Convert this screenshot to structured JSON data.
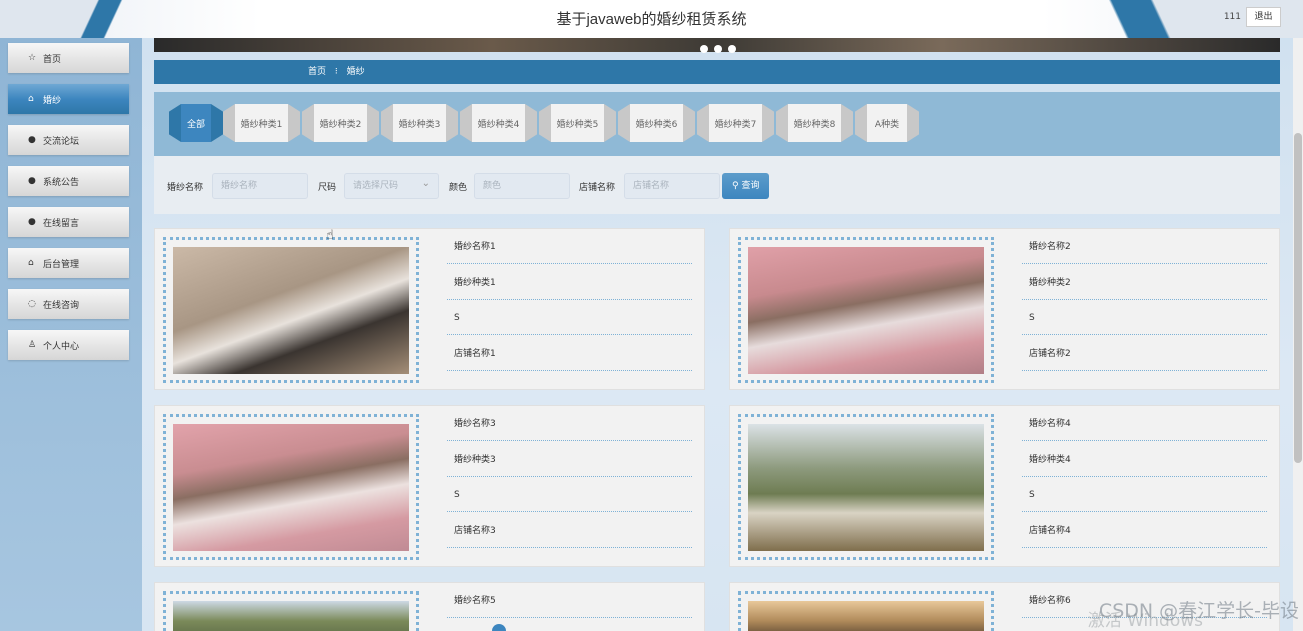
{
  "header": {
    "title": "基于javaweb的婚纱租赁系统",
    "user": "111",
    "logout_label": "退出"
  },
  "sidebar": {
    "items": [
      {
        "label": "首页",
        "icon": "☆"
      },
      {
        "label": "婚纱",
        "icon": "⌂"
      },
      {
        "label": "交流论坛",
        "icon": "●"
      },
      {
        "label": "系统公告",
        "icon": "●"
      },
      {
        "label": "在线留言",
        "icon": "●"
      },
      {
        "label": "后台管理",
        "icon": "⌂"
      },
      {
        "label": "在线咨询",
        "icon": "◌"
      },
      {
        "label": "个人中心",
        "icon": "♙"
      }
    ]
  },
  "breadcrumb": {
    "home": "首页",
    "separator": "⁝",
    "current": "婚纱"
  },
  "categories": [
    "全部",
    "婚纱种类1",
    "婚纱种类2",
    "婚纱种类3",
    "婚纱种类4",
    "婚纱种类5",
    "婚纱种类6",
    "婚纱种类7",
    "婚纱种类8",
    "A种类"
  ],
  "search": {
    "name_label": "婚纱名称",
    "name_placeholder": "婚纱名称",
    "size_label": "尺码",
    "size_placeholder": "请选择尺码",
    "color_label": "颜色",
    "color_placeholder": "颜色",
    "shop_label": "店铺名称",
    "shop_placeholder": "店铺名称",
    "query_label": "查询"
  },
  "products": [
    {
      "name": "婚纱名称1",
      "type": "婚纱种类1",
      "size": "S",
      "shop": "店铺名称1"
    },
    {
      "name": "婚纱名称2",
      "type": "婚纱种类2",
      "size": "S",
      "shop": "店铺名称2"
    },
    {
      "name": "婚纱名称3",
      "type": "婚纱种类3",
      "size": "S",
      "shop": "店铺名称3"
    },
    {
      "name": "婚纱名称4",
      "type": "婚纱种类4",
      "size": "S",
      "shop": "店铺名称4"
    },
    {
      "name": "婚纱名称5"
    },
    {
      "name": "婚纱名称6"
    }
  ],
  "watermarks": {
    "csdn": "CSDN @春江学长-毕设",
    "windows": "激活 Windows"
  },
  "colors": {
    "primary": "#2e77a8",
    "accent": "#3d86bf",
    "panel": "#8fb9d6"
  }
}
